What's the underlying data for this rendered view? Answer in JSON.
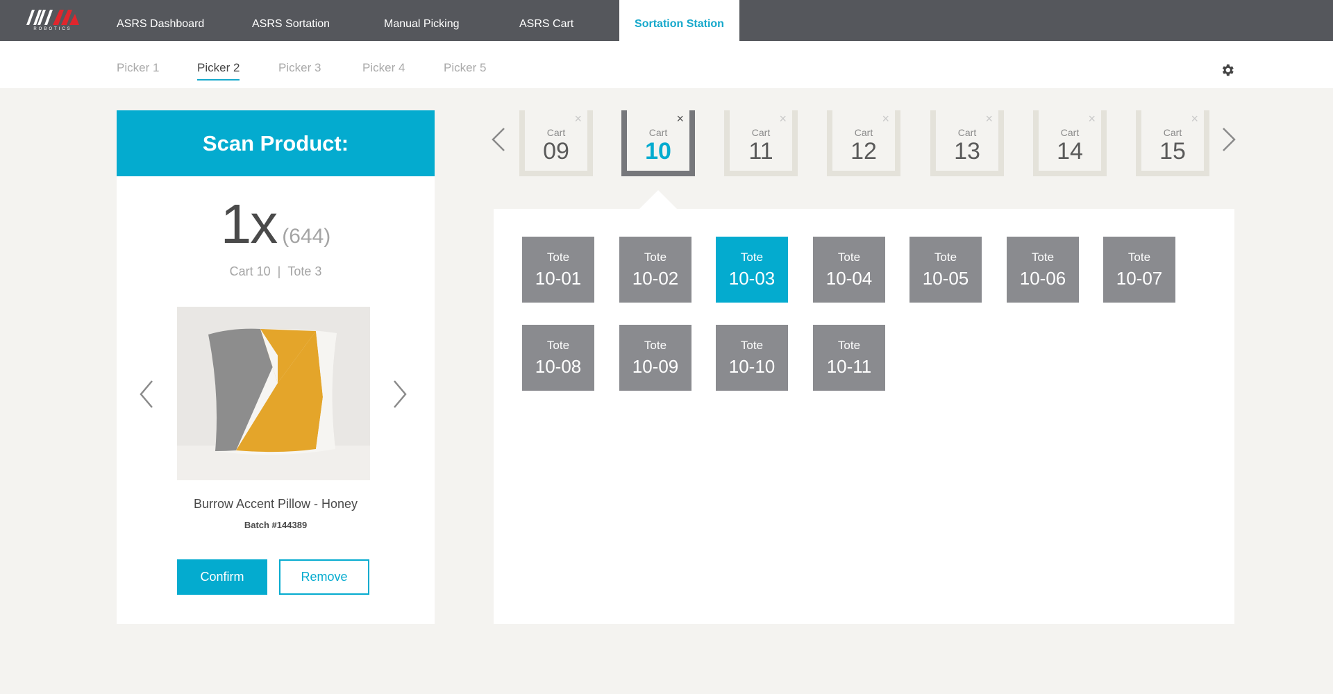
{
  "brand": {
    "logo_text": "INVIA",
    "logo_sub": "ROBOTICS",
    "accent": "#04abcf",
    "nav_bg": "#55575c"
  },
  "nav": {
    "items": [
      {
        "label": "ASRS Dashboard"
      },
      {
        "label": "ASRS Sortation"
      },
      {
        "label": "Manual Picking"
      },
      {
        "label": "ASRS Cart"
      },
      {
        "label": "Sortation Station",
        "active": true
      }
    ]
  },
  "pickers": {
    "tabs": [
      {
        "label": "Picker 1"
      },
      {
        "label": "Picker 2",
        "active": true
      },
      {
        "label": "Picker 3"
      },
      {
        "label": "Picker 4"
      },
      {
        "label": "Picker 5"
      }
    ],
    "settings_icon": "gear-icon"
  },
  "scan": {
    "title": "Scan Product:",
    "quantity": "1x",
    "quantity_total": "(644)",
    "cart": "Cart 10",
    "separator": "|",
    "tote": "Tote 3",
    "product_name": "Burrow Accent Pillow - Honey",
    "batch": "Batch #144389",
    "confirm_label": "Confirm",
    "remove_label": "Remove"
  },
  "carts": [
    {
      "label": "Cart",
      "number": "09"
    },
    {
      "label": "Cart",
      "number": "10",
      "active": true
    },
    {
      "label": "Cart",
      "number": "11"
    },
    {
      "label": "Cart",
      "number": "12"
    },
    {
      "label": "Cart",
      "number": "13"
    },
    {
      "label": "Cart",
      "number": "14"
    },
    {
      "label": "Cart",
      "number": "15"
    }
  ],
  "close_glyph": "×",
  "totes": [
    {
      "label": "Tote",
      "number": "10-01"
    },
    {
      "label": "Tote",
      "number": "10-02"
    },
    {
      "label": "Tote",
      "number": "10-03",
      "active": true
    },
    {
      "label": "Tote",
      "number": "10-04"
    },
    {
      "label": "Tote",
      "number": "10-05"
    },
    {
      "label": "Tote",
      "number": "10-06"
    },
    {
      "label": "Tote",
      "number": "10-07"
    },
    {
      "label": "Tote",
      "number": "10-08"
    },
    {
      "label": "Tote",
      "number": "10-09"
    },
    {
      "label": "Tote",
      "number": "10-10"
    },
    {
      "label": "Tote",
      "number": "10-11"
    }
  ]
}
